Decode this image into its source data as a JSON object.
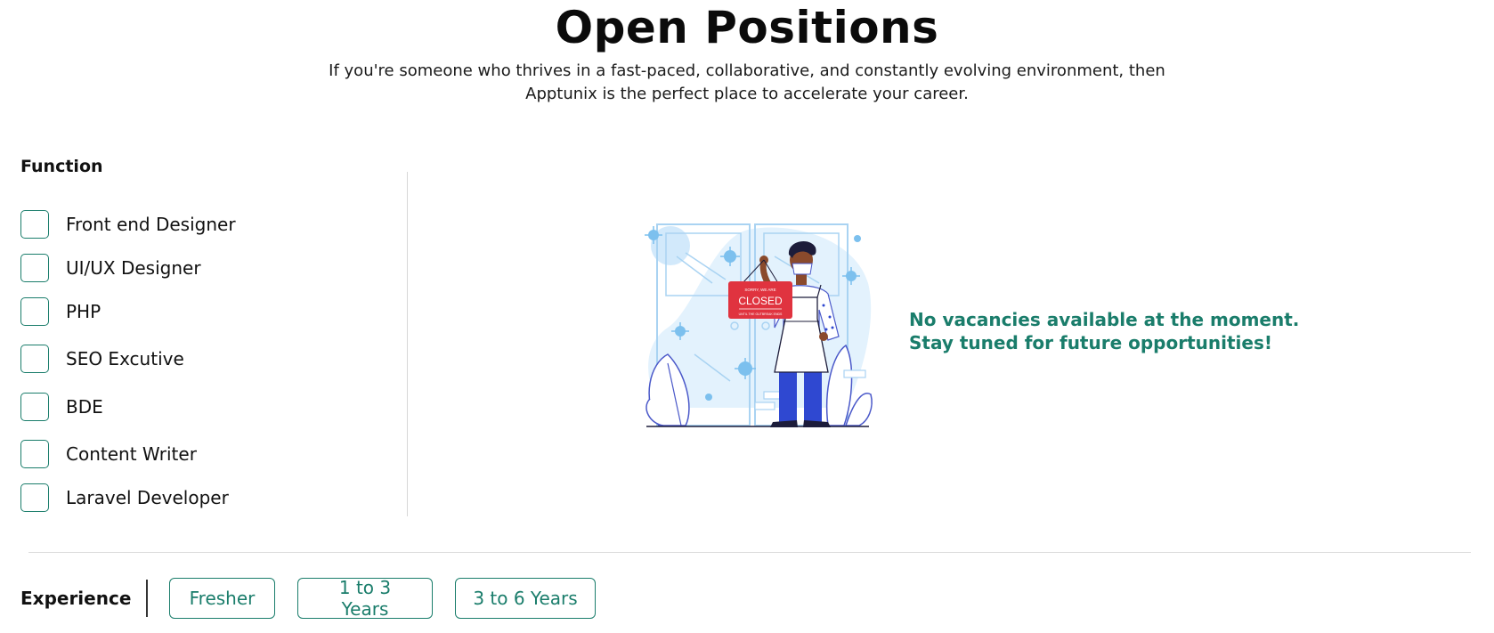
{
  "header": {
    "title": "Open Positions",
    "subtitle": "If you're someone who thrives in a fast-paced, collaborative, and constantly evolving environment, then Apptunix is the perfect place to accelerate your career."
  },
  "filters": {
    "function_heading": "Function",
    "functions": [
      {
        "label": "Front end Designer",
        "checked": false
      },
      {
        "label": "UI/UX Designer",
        "checked": false
      },
      {
        "label": "PHP",
        "checked": false
      },
      {
        "label": "SEO Excutive",
        "checked": false
      },
      {
        "label": "BDE",
        "checked": false
      },
      {
        "label": "Content Writer",
        "checked": false
      },
      {
        "label": "Laravel Developer",
        "checked": false
      }
    ],
    "experience_heading": "Experience",
    "experience_options": [
      "Fresher",
      "1 to 3 Years",
      "3 to 6 Years"
    ]
  },
  "empty_state": {
    "message": "No vacancies available at the moment. Stay tuned for future opportunities!",
    "illustration_icon": "closed-shop-illustration",
    "sign_text": "CLOSED"
  },
  "colors": {
    "accent": "#1a7d6b",
    "sign_red": "#e0333f",
    "illustration_blue": "#7cc0ee"
  }
}
